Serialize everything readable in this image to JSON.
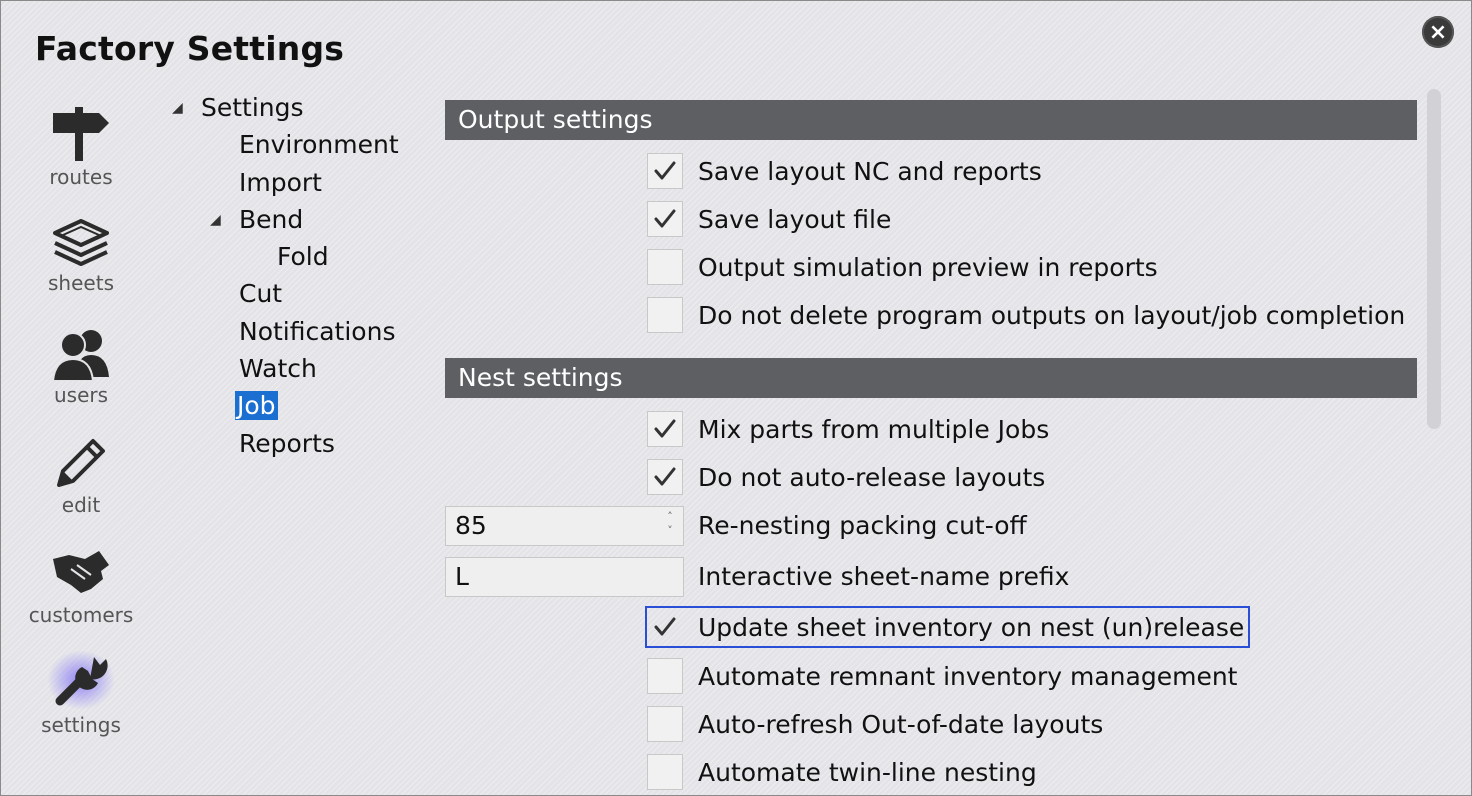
{
  "window": {
    "title": "Factory Settings",
    "close_symbol": "×"
  },
  "nav": [
    {
      "label": "routes",
      "icon": "signpost-icon"
    },
    {
      "label": "sheets",
      "icon": "layers-icon"
    },
    {
      "label": "users",
      "icon": "users-icon"
    },
    {
      "label": "edit",
      "icon": "pencil-icon"
    },
    {
      "label": "customers",
      "icon": "handshake-icon"
    },
    {
      "label": "settings",
      "icon": "wrench-icon"
    }
  ],
  "tree": {
    "root": "Settings",
    "environment": "Environment",
    "import": "Import",
    "bend": "Bend",
    "fold": "Fold",
    "cut": "Cut",
    "notifications": "Notifications",
    "watch": "Watch",
    "job": "Job",
    "reports": "Reports",
    "selected": "Job"
  },
  "output_settings": {
    "header": "Output settings",
    "options": [
      {
        "label": "Save layout NC and reports",
        "checked": true
      },
      {
        "label": "Save layout file",
        "checked": true
      },
      {
        "label": "Output simulation preview in reports",
        "checked": false
      },
      {
        "label": "Do not delete program outputs on layout/job completion",
        "checked": false
      }
    ]
  },
  "nest_settings": {
    "header": "Nest settings",
    "options_top": [
      {
        "label": "Mix parts from multiple Jobs",
        "checked": true
      },
      {
        "label": "Do not auto-release layouts",
        "checked": true
      }
    ],
    "cutoff": {
      "value": "85",
      "label": "Re-nesting packing cut-off"
    },
    "prefix": {
      "value": "L",
      "label": "Interactive sheet-name prefix"
    },
    "options_bottom": [
      {
        "label": "Update sheet inventory on nest (un)release",
        "checked": true,
        "focused": true
      },
      {
        "label": "Automate remnant inventory management",
        "checked": false
      },
      {
        "label": "Auto-refresh Out-of-date layouts",
        "checked": false
      },
      {
        "label": "Automate twin-line nesting",
        "checked": false
      }
    ]
  },
  "colors": {
    "section_header": "#5e5f63",
    "selection": "#1a6fd1",
    "focus_outline": "#2a4fd6",
    "settings_glow": "#7b6cf6"
  }
}
